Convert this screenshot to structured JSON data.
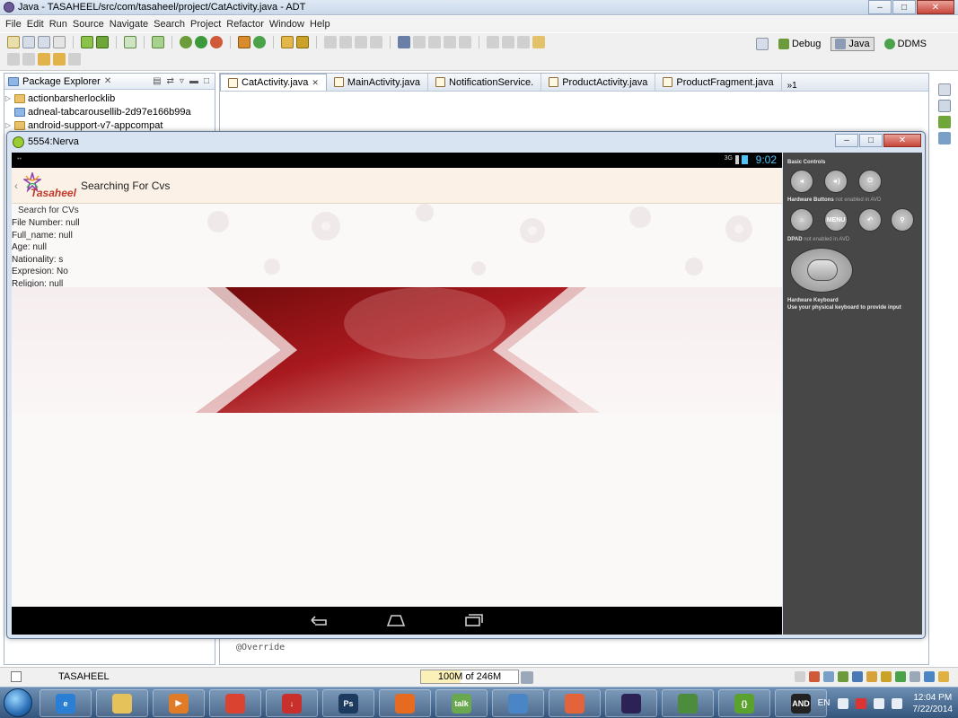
{
  "window": {
    "title": "Java - TASAHEEL/src/com/tasaheel/project/CatActivity.java - ADT",
    "min": "–",
    "max": "□",
    "close": "✕"
  },
  "menu": [
    "File",
    "Edit",
    "Run",
    "Source",
    "Navigate",
    "Search",
    "Project",
    "Refactor",
    "Window",
    "Help"
  ],
  "perspectives": [
    {
      "label": "Debug",
      "active": false
    },
    {
      "label": "Java",
      "active": true
    },
    {
      "label": "DDMS",
      "active": false
    }
  ],
  "package_explorer": {
    "tab_label": "Package Explorer",
    "close": "✕",
    "items": [
      {
        "label": "actionbarsherlocklib",
        "type": "project"
      },
      {
        "label": "adneal-tabcarousellib-2d97e166b99a",
        "type": "folder"
      },
      {
        "label": "android-support-v7-appcompat",
        "type": "project"
      }
    ]
  },
  "editor": {
    "tabs": [
      {
        "label": "CatActivity.java",
        "active": true,
        "close": "✕"
      },
      {
        "label": "MainActivity.java",
        "active": false
      },
      {
        "label": "NotificationService.",
        "active": false
      },
      {
        "label": "ProductActivity.java",
        "active": false
      },
      {
        "label": "ProductFragment.java",
        "active": false
      }
    ],
    "more_tabs": "»1",
    "code_bottom": "@Override"
  },
  "statusbar": {
    "project": "TASAHEEL",
    "heap": "100M of 246M",
    "heap_used_fraction": 0.41
  },
  "emulator": {
    "title": "5554:Nerva",
    "android_status": {
      "time": "9:02",
      "network": "3G"
    },
    "actionbar": {
      "up": "‹",
      "logo_text": "Tasaheel",
      "title": "Searching For Cvs"
    },
    "content": {
      "search_label": "Search for CVs",
      "fields": [
        "File Number: null",
        "Full_name: null",
        "Age: null",
        "Nationality: s",
        "Expresion: No",
        "Religion: null"
      ]
    },
    "controls": {
      "basic_title": "Basic Controls",
      "hw_title": "Hardware Buttons",
      "hw_note": "not enabled in AVD",
      "menu_label": "MENU",
      "dpad_title": "DPAD",
      "dpad_note": "not enabled in AVD",
      "kb_title": "Hardware Keyboard",
      "kb_note": "Use your physical keyboard to provide input"
    }
  },
  "taskbar": {
    "lang": "EN",
    "time": "12:04 PM",
    "date": "7/22/2014",
    "apps": [
      {
        "name": "ie",
        "label": "e",
        "color": "#2a7fd4"
      },
      {
        "name": "explorer",
        "label": "",
        "color": "#e6c35a"
      },
      {
        "name": "media-player",
        "label": "▶",
        "color": "#e07b28"
      },
      {
        "name": "chrome",
        "label": "",
        "color": "#d9432f"
      },
      {
        "name": "download",
        "label": "↓",
        "color": "#c9302c"
      },
      {
        "name": "photoshop",
        "label": "Ps",
        "color": "#1d3a5f"
      },
      {
        "name": "firefox",
        "label": "",
        "color": "#e66a1f"
      },
      {
        "name": "talk",
        "label": "talk",
        "color": "#6aa84f"
      },
      {
        "name": "network",
        "label": "",
        "color": "#4a86c5"
      },
      {
        "name": "xampp",
        "label": "",
        "color": "#e3643b"
      },
      {
        "name": "eclipse",
        "label": "",
        "color": "#2c2255"
      },
      {
        "name": "chart-app",
        "label": "",
        "color": "#4c8c3d"
      },
      {
        "name": "braces-app",
        "label": "{}",
        "color": "#5aa12f"
      },
      {
        "name": "android-emulator",
        "label": "AND",
        "color": "#222222"
      }
    ]
  }
}
